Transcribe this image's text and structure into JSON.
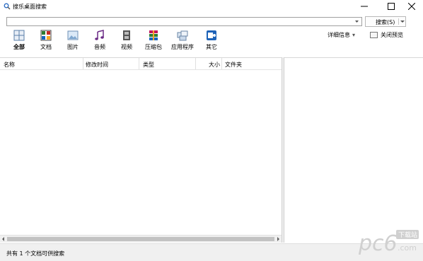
{
  "window": {
    "title": "搜乐桌面搜索",
    "icon": "magnifier-icon"
  },
  "search": {
    "value": "",
    "placeholder": "",
    "button_label": "搜索(S)"
  },
  "toolbar": [
    {
      "label": "全部",
      "icon": "all-grid-icon"
    },
    {
      "label": "文档",
      "icon": "document-icon"
    },
    {
      "label": "图片",
      "icon": "picture-icon"
    },
    {
      "label": "音频",
      "icon": "music-note-icon"
    },
    {
      "label": "视频",
      "icon": "film-icon"
    },
    {
      "label": "压缩包",
      "icon": "archive-icon"
    },
    {
      "label": "应用程序",
      "icon": "application-icon"
    },
    {
      "label": "其它",
      "icon": "other-icon"
    }
  ],
  "actions": {
    "details_label": "详细信息",
    "close_preview_label": "关闭预览"
  },
  "table": {
    "columns": [
      "名称",
      "修改时间",
      "类型",
      "大小",
      "文件夹"
    ]
  },
  "status": {
    "text": "共有 1 个文档可供搜索"
  },
  "watermark": {
    "text": "pc6",
    "subtext": "下载站",
    "domain": ".com"
  },
  "colors": {
    "accent_blue": "#2b6cc4",
    "watermark_gray": "#d0d0d0"
  }
}
